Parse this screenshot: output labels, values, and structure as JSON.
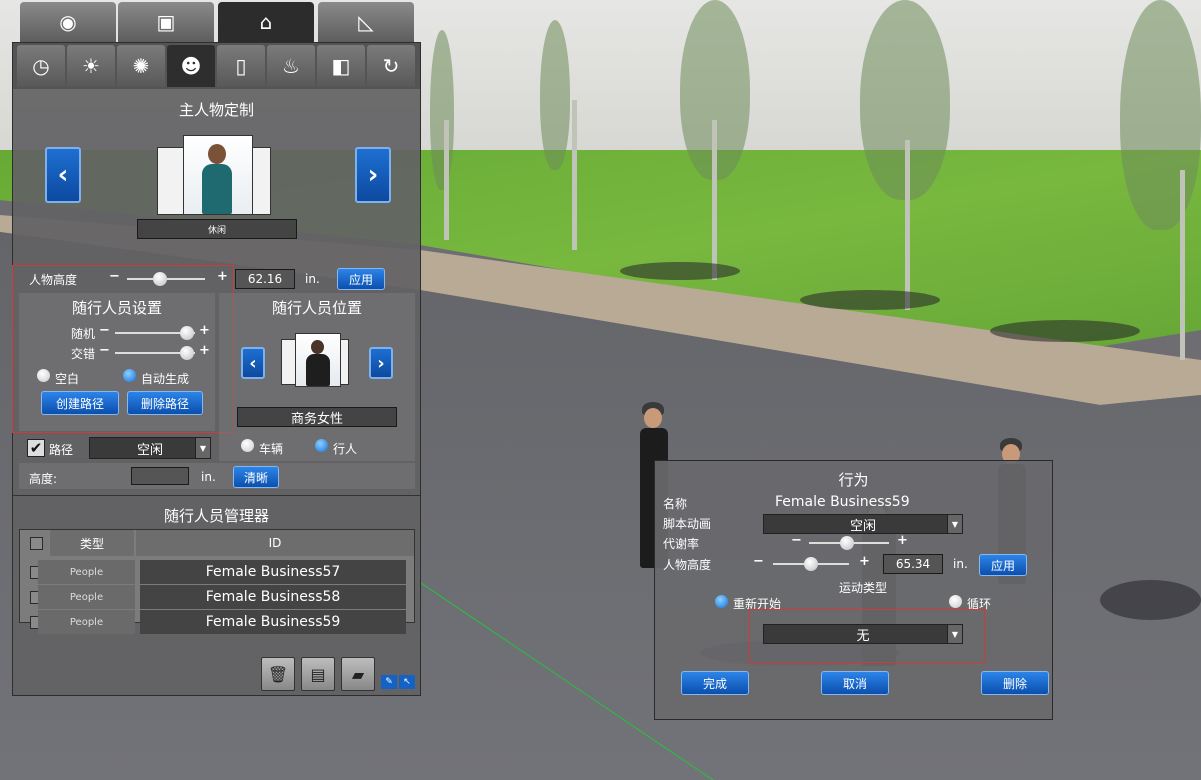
{
  "top_tabs": [
    {
      "icon": "compass-icon"
    },
    {
      "icon": "camera-person-icon"
    },
    {
      "icon": "scene-objects-icon"
    },
    {
      "icon": "ruler-icon"
    }
  ],
  "sub_tabs": [
    {
      "icon": "clock-icon"
    },
    {
      "icon": "sunrise-icon"
    },
    {
      "icon": "lightbulb-icon"
    },
    {
      "icon": "people-icon"
    },
    {
      "icon": "door-icon"
    },
    {
      "icon": "fire-icon"
    },
    {
      "icon": "camera-icon"
    },
    {
      "icon": "rotate-icon"
    }
  ],
  "main_character": {
    "title": "主人物定制",
    "outfit_label": "休闲",
    "height_label": "人物高度",
    "height_value": "62.16",
    "height_unit": "in.",
    "height_slider": 0.42,
    "apply_label": "应用"
  },
  "follower_settings": {
    "title": "随行人员设置",
    "random_label": "随机",
    "random_value": 0.9,
    "stagger_label": "交错",
    "stagger_value": 0.9,
    "radio_blank": "空白",
    "radio_auto": "自动生成",
    "create_path": "创建路径",
    "delete_path": "删除路径",
    "path_label": "路径",
    "path_dropdown": "空闲",
    "height_label": "高度:",
    "height_value": "",
    "height_unit": "in.",
    "clear_label": "清晰"
  },
  "follower_position": {
    "title": "随行人员位置",
    "character_name": "商务女性",
    "radio_vehicle": "车辆",
    "radio_pedestrian": "行人"
  },
  "manager": {
    "title": "随行人员管理器",
    "col_type": "类型",
    "col_id": "ID",
    "rows": [
      {
        "type": "People",
        "id": "Female Business57"
      },
      {
        "type": "People",
        "id": "Female Business58"
      },
      {
        "type": "People",
        "id": "Female Business59"
      }
    ]
  },
  "behavior_dialog": {
    "title": "行为",
    "name_label": "名称",
    "name_value": "Female Business59",
    "animation_label": "脚本动画",
    "animation_value": "空闲",
    "rate_label": "代谢率",
    "rate_value": 0.47,
    "height_label": "人物高度",
    "height_value": "65.34",
    "height_slider": 0.5,
    "height_unit": "in.",
    "apply_label": "应用",
    "motion_type_label": "运动类型",
    "radio_restart": "重新开始",
    "radio_loop": "循环",
    "motion_dropdown": "无",
    "done_label": "完成",
    "cancel_label": "取消",
    "delete_label": "删除"
  },
  "colors": {
    "accent_blue": "#0c4aa0",
    "highlight_red": "#d23a3a",
    "grass": "#6fb03a",
    "road": "#6a6b6f"
  }
}
